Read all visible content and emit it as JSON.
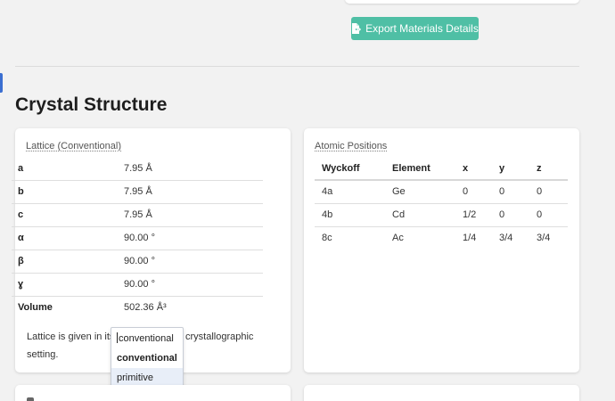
{
  "header": {
    "export_button_label": "Export Materials Details",
    "export_icon": "file-export-icon",
    "accent_color": "#4fbfa5"
  },
  "section": {
    "title": "Crystal Structure"
  },
  "lattice_card": {
    "heading": "Lattice (Conventional)",
    "rows": [
      {
        "label": "a",
        "value": "7.95 Å"
      },
      {
        "label": "b",
        "value": "7.95 Å"
      },
      {
        "label": "c",
        "value": "7.95 Å"
      },
      {
        "label": "α",
        "value": "90.00 °"
      },
      {
        "label": "β",
        "value": "90.00 °"
      },
      {
        "label": "ɣ",
        "value": "90.00 °"
      },
      {
        "label": "Volume",
        "value": "502.36 Å³"
      }
    ],
    "note_before": "Lattice is given in its",
    "note_after": "crystallographic",
    "note_end": "setting.",
    "dropdown": {
      "current": "conventional",
      "options": [
        "conventional",
        "primitive"
      ]
    }
  },
  "atomic_card": {
    "heading": "Atomic Positions",
    "columns": [
      "Wyckoff",
      "Element",
      "x",
      "y",
      "z"
    ],
    "rows": [
      [
        "4a",
        "Ge",
        "0",
        "0",
        "0"
      ],
      [
        "4b",
        "Cd",
        "1/2",
        "0",
        "0"
      ],
      [
        "8c",
        "Ac",
        "1/4",
        "3/4",
        "3/4"
      ]
    ]
  }
}
